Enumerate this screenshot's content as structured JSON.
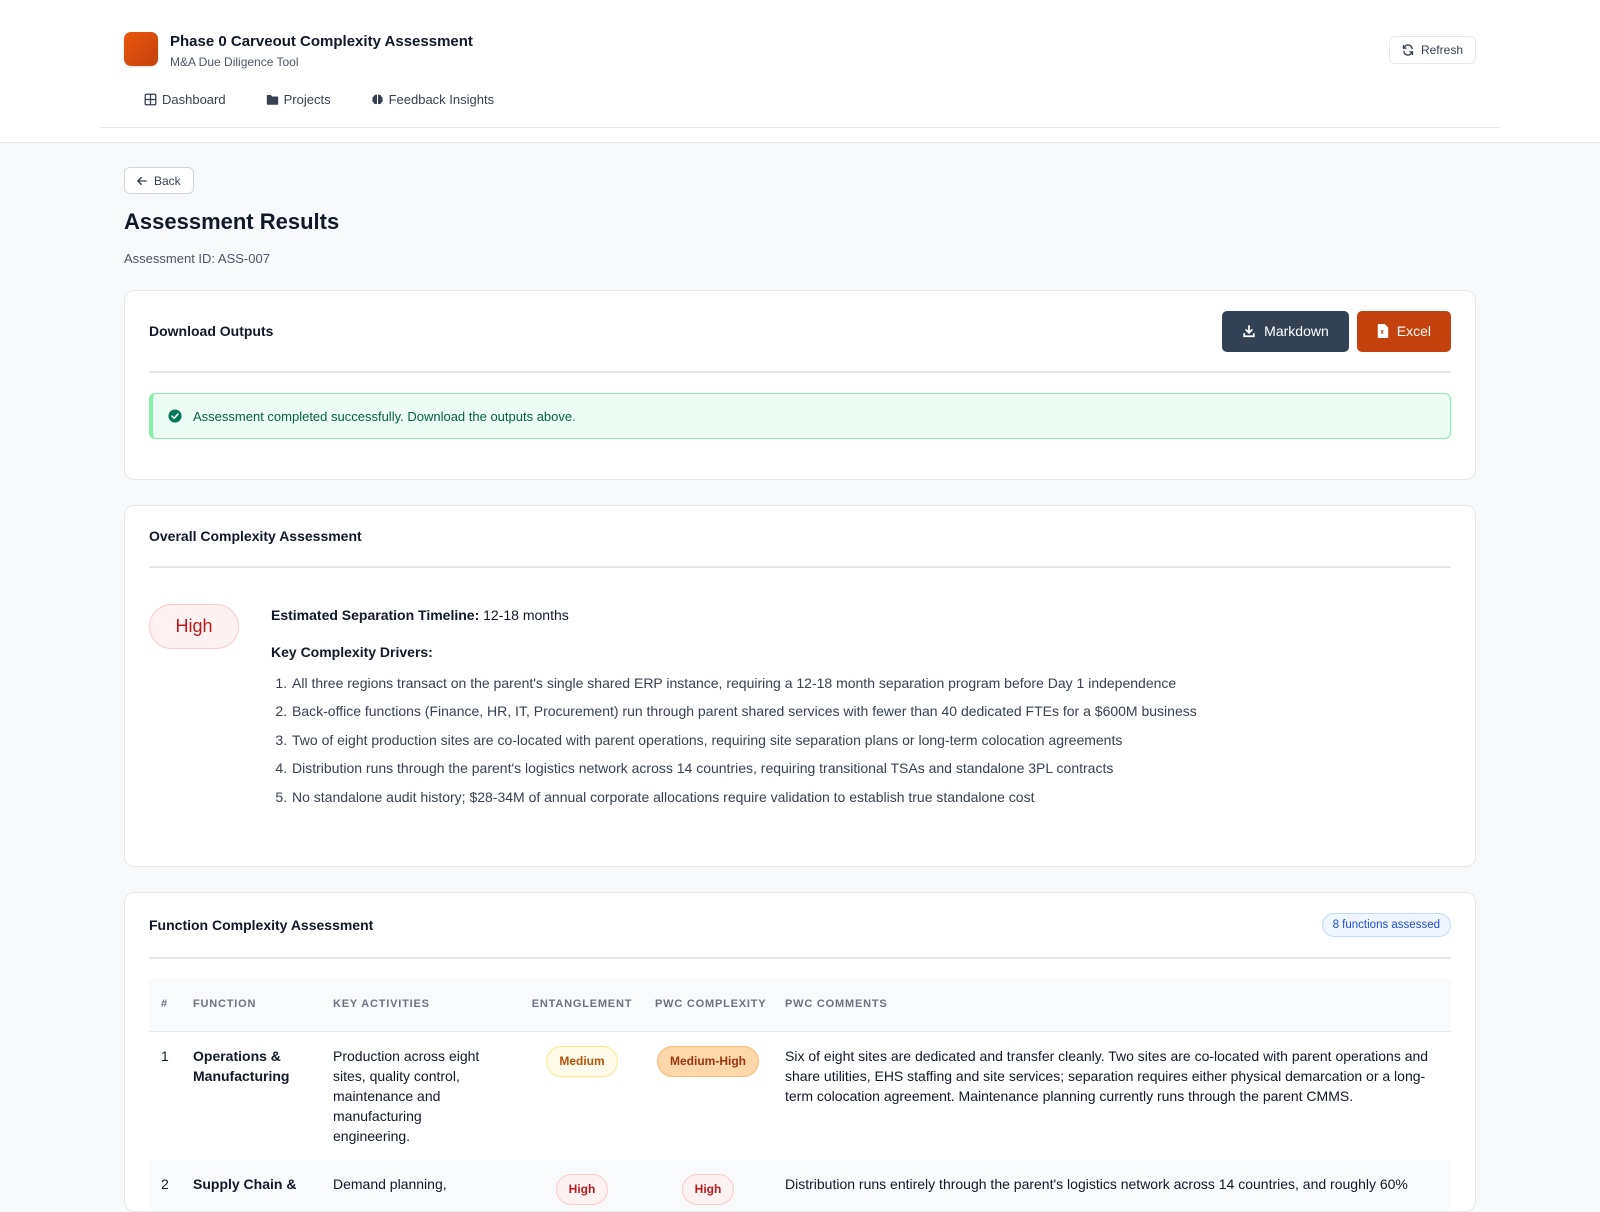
{
  "app": {
    "title": "Phase 0 Carveout Complexity Assessment",
    "subtitle": "M&A Due Diligence Tool",
    "refresh_label": "Refresh",
    "brand_color": "#c2410c"
  },
  "nav": [
    {
      "label": "Dashboard",
      "icon": "grid-icon"
    },
    {
      "label": "Projects",
      "icon": "folder-icon"
    },
    {
      "label": "Feedback Insights",
      "icon": "brain-icon"
    }
  ],
  "page": {
    "back_label": "Back",
    "title": "Assessment Results",
    "assessment_id": "Assessment ID: ASS-007"
  },
  "download": {
    "title": "Download Outputs",
    "markdown_label": "Markdown",
    "excel_label": "Excel",
    "success_message": "Assessment completed successfully. Download the outputs above."
  },
  "overall": {
    "title": "Overall Complexity Assessment",
    "level": "High",
    "timeline_label": "Estimated Separation Timeline:",
    "timeline_value": "12-18 months",
    "drivers_label": "Key Complexity Drivers:",
    "drivers": [
      "All three regions transact on the parent's single shared ERP instance, requiring a 12-18 month separation program before Day 1 independence",
      "Back-office functions (Finance, HR, IT, Procurement) run through parent shared services with fewer than 40 dedicated FTEs for a $600M business",
      "Two of eight production sites are co-located with parent operations, requiring site separation plans or long-term colocation agreements",
      "Distribution runs through the parent's logistics network across 14 countries, requiring transitional TSAs and standalone 3PL contracts",
      "No standalone audit history; $28-34M of annual corporate allocations require validation to establish true standalone cost"
    ]
  },
  "functions": {
    "title": "Function Complexity Assessment",
    "count_label": "8 functions assessed",
    "columns": {
      "num": "#",
      "function": "FUNCTION",
      "activities": "KEY ACTIVITIES",
      "entanglement": "ENTANGLEMENT",
      "pwc_complexity": "PWC COMPLEXITY",
      "pwc_comments": "PWC COMMENTS"
    },
    "rows": [
      {
        "num": "1",
        "function": "Operations & Manufacturing",
        "activities": "Production across eight sites, quality control, maintenance and manufacturing engineering.",
        "entanglement": "Medium",
        "complexity": "Medium-High",
        "comments": "Six of eight sites are dedicated and transfer cleanly. Two sites are co-located with parent operations and share utilities, EHS staffing and site services; separation requires either physical demarcation or a long-term colocation agreement. Maintenance planning currently runs through the parent CMMS."
      },
      {
        "num": "2",
        "function": "Supply Chain &",
        "activities": "Demand planning,",
        "entanglement": "High",
        "complexity": "High",
        "comments": "Distribution runs entirely through the parent's logistics network across 14 countries, and roughly 60%"
      }
    ]
  }
}
